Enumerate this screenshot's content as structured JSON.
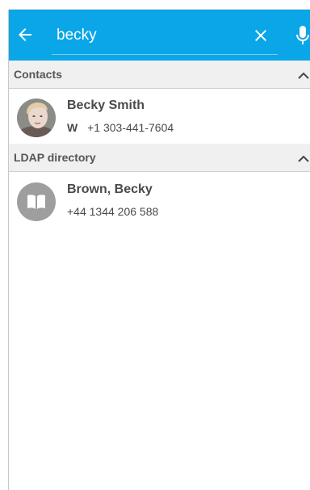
{
  "search": {
    "query": "becky",
    "back_icon": "arrow-left-icon",
    "clear_icon": "close-icon",
    "mic_icon": "microphone-icon"
  },
  "sections": [
    {
      "title": "Contacts",
      "toggle_icon": "chevron-up-icon",
      "results": [
        {
          "name": "Becky Smith",
          "phone_type": "W",
          "phone": "+1 303-441-7604",
          "avatar": "contact-photo"
        }
      ]
    },
    {
      "title": "LDAP directory",
      "toggle_icon": "chevron-up-icon",
      "results": [
        {
          "name": "Brown, Becky",
          "phone": "+44 1344 206 588",
          "avatar": "book-icon"
        }
      ]
    }
  ],
  "colors": {
    "header_bg": "#0aa6e8",
    "section_bg": "#f0f0f0",
    "text": "#4a4a4a",
    "avatar_gray": "#9e9e9e"
  }
}
